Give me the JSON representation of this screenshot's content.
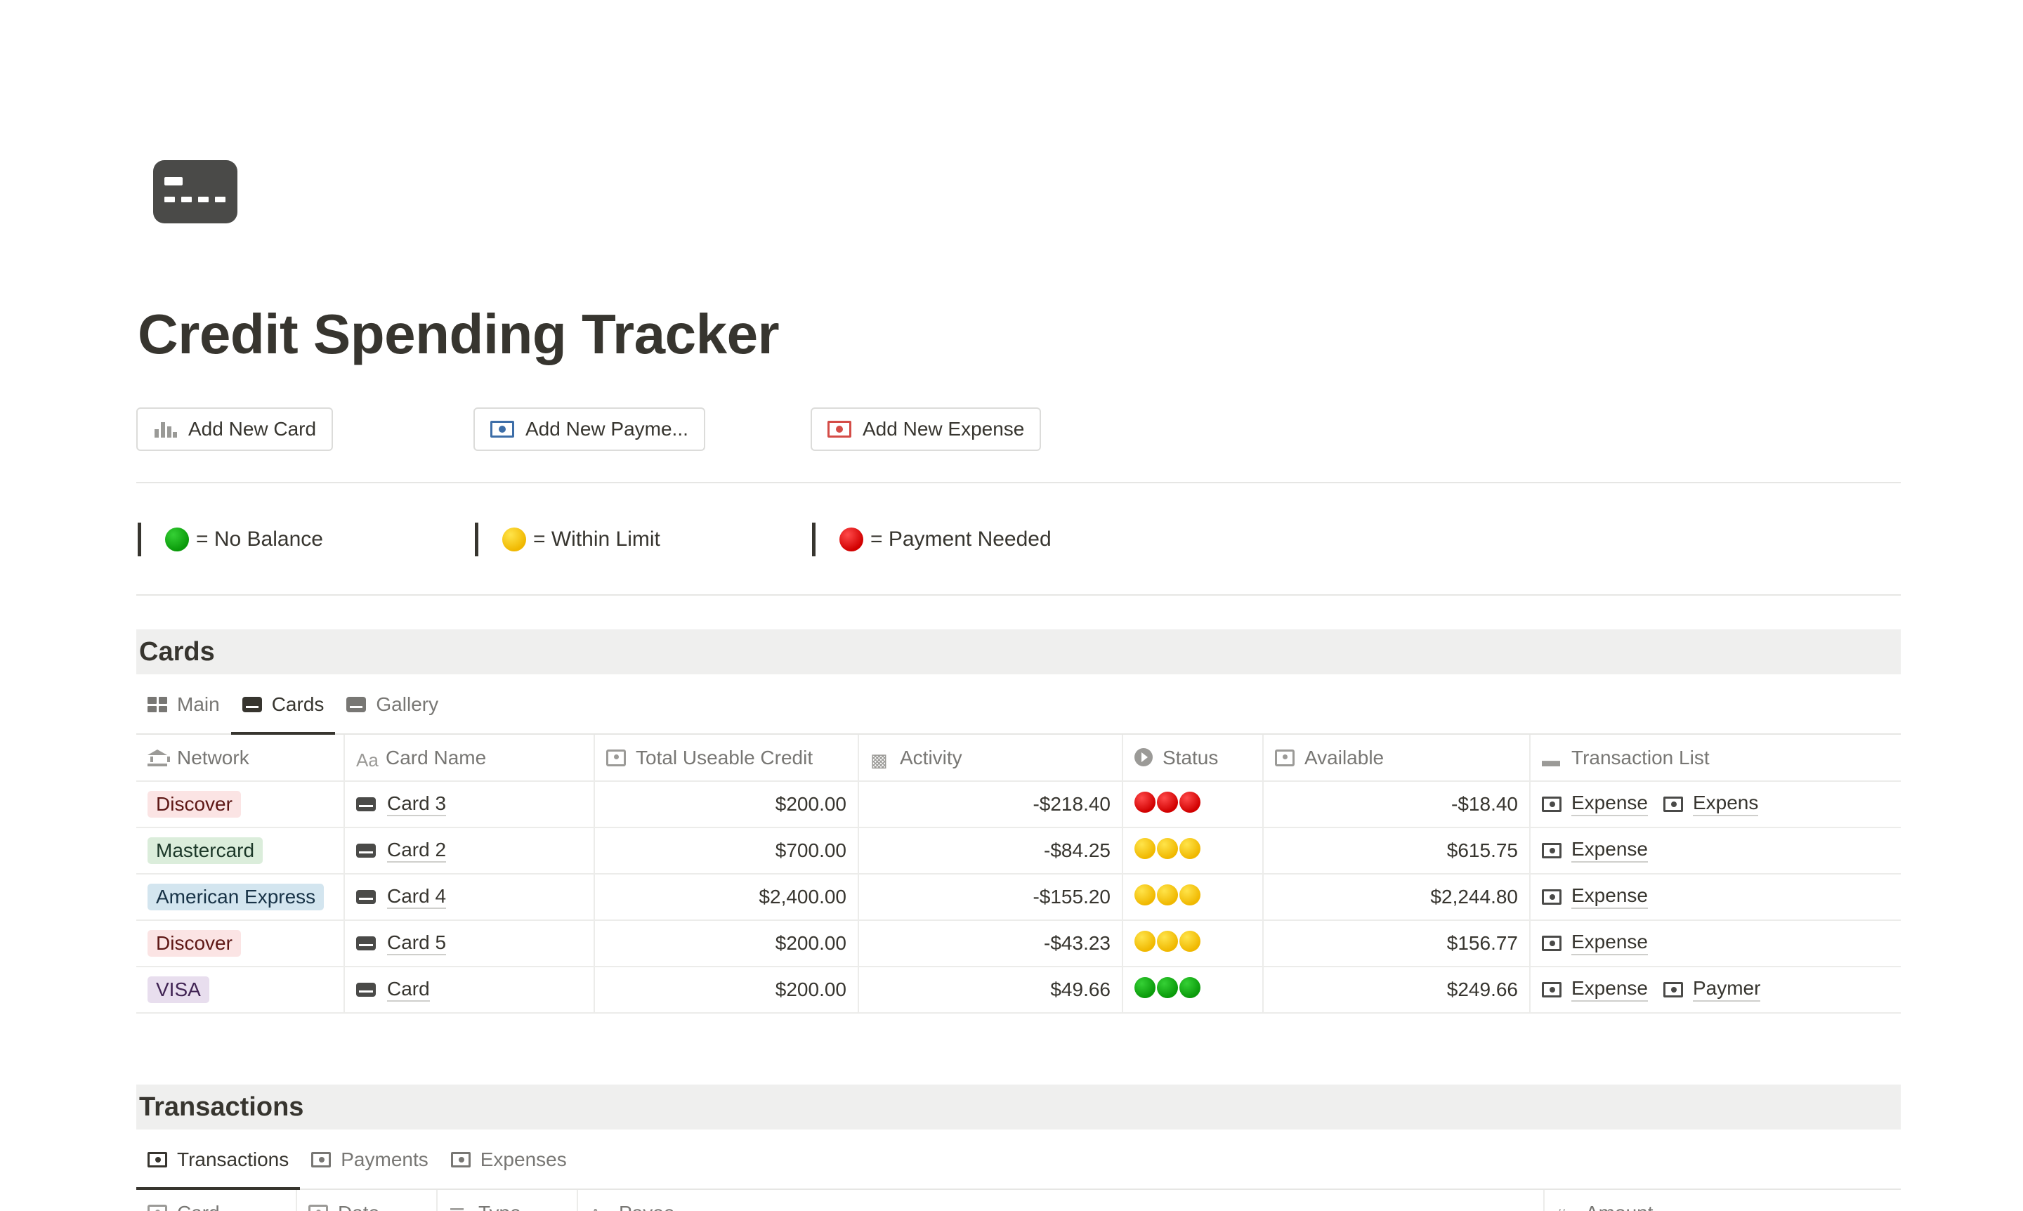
{
  "page": {
    "title": "Credit Spending Tracker",
    "icon": "credit-card-icon"
  },
  "buttons": [
    {
      "label": "Add New Card",
      "icon": "bar-chart-icon"
    },
    {
      "label": "Add New Payme...",
      "icon": "money-icon",
      "color": "#3d6ea8"
    },
    {
      "label": "Add New Expense",
      "icon": "money-icon",
      "color": "#d44c47"
    }
  ],
  "legend": [
    {
      "label": "= No Balance",
      "color": "green"
    },
    {
      "label": "= Within Limit",
      "color": "yellow"
    },
    {
      "label": "= Payment Needed",
      "color": "red"
    }
  ],
  "cards_section": {
    "title": "Cards",
    "tabs": [
      "Main",
      "Cards",
      "Gallery"
    ],
    "active_tab": "Cards",
    "columns": [
      "Network",
      "Card Name",
      "Total Useable Credit",
      "Activity",
      "Status",
      "Available",
      "Transaction List"
    ],
    "rows": [
      {
        "network": "Discover",
        "card": "Card 3",
        "credit": "$200.00",
        "activity": "-$218.40",
        "status": "red",
        "available": "-$18.40",
        "tx": [
          "Expense",
          "Expens"
        ]
      },
      {
        "network": "Mastercard",
        "card": "Card 2",
        "credit": "$700.00",
        "activity": "-$84.25",
        "status": "yellow",
        "available": "$615.75",
        "tx": [
          "Expense"
        ]
      },
      {
        "network": "American Express",
        "card": "Card 4",
        "credit": "$2,400.00",
        "activity": "-$155.20",
        "status": "yellow",
        "available": "$2,244.80",
        "tx": [
          "Expense"
        ]
      },
      {
        "network": "Discover",
        "card": "Card 5",
        "credit": "$200.00",
        "activity": "-$43.23",
        "status": "yellow",
        "available": "$156.77",
        "tx": [
          "Expense"
        ]
      },
      {
        "network": "VISA",
        "card": "Card",
        "credit": "$200.00",
        "activity": "$49.66",
        "status": "green",
        "available": "$249.66",
        "tx": [
          "Expense",
          "Paymer"
        ]
      }
    ],
    "network_colors": {
      "Discover": {
        "bg": "#fbe4e4",
        "fg": "#5d1715"
      },
      "Mastercard": {
        "bg": "#dbeddb",
        "fg": "#1c3829"
      },
      "American Express": {
        "bg": "#d3e5ef",
        "fg": "#183347"
      },
      "VISA": {
        "bg": "#e8deee",
        "fg": "#412454"
      }
    }
  },
  "transactions_section": {
    "title": "Transactions",
    "tabs": [
      "Transactions",
      "Payments",
      "Expenses"
    ],
    "active_tab": "Transactions",
    "columns": [
      "Card",
      "Date",
      "Type",
      "Payee",
      "Amount"
    ]
  }
}
